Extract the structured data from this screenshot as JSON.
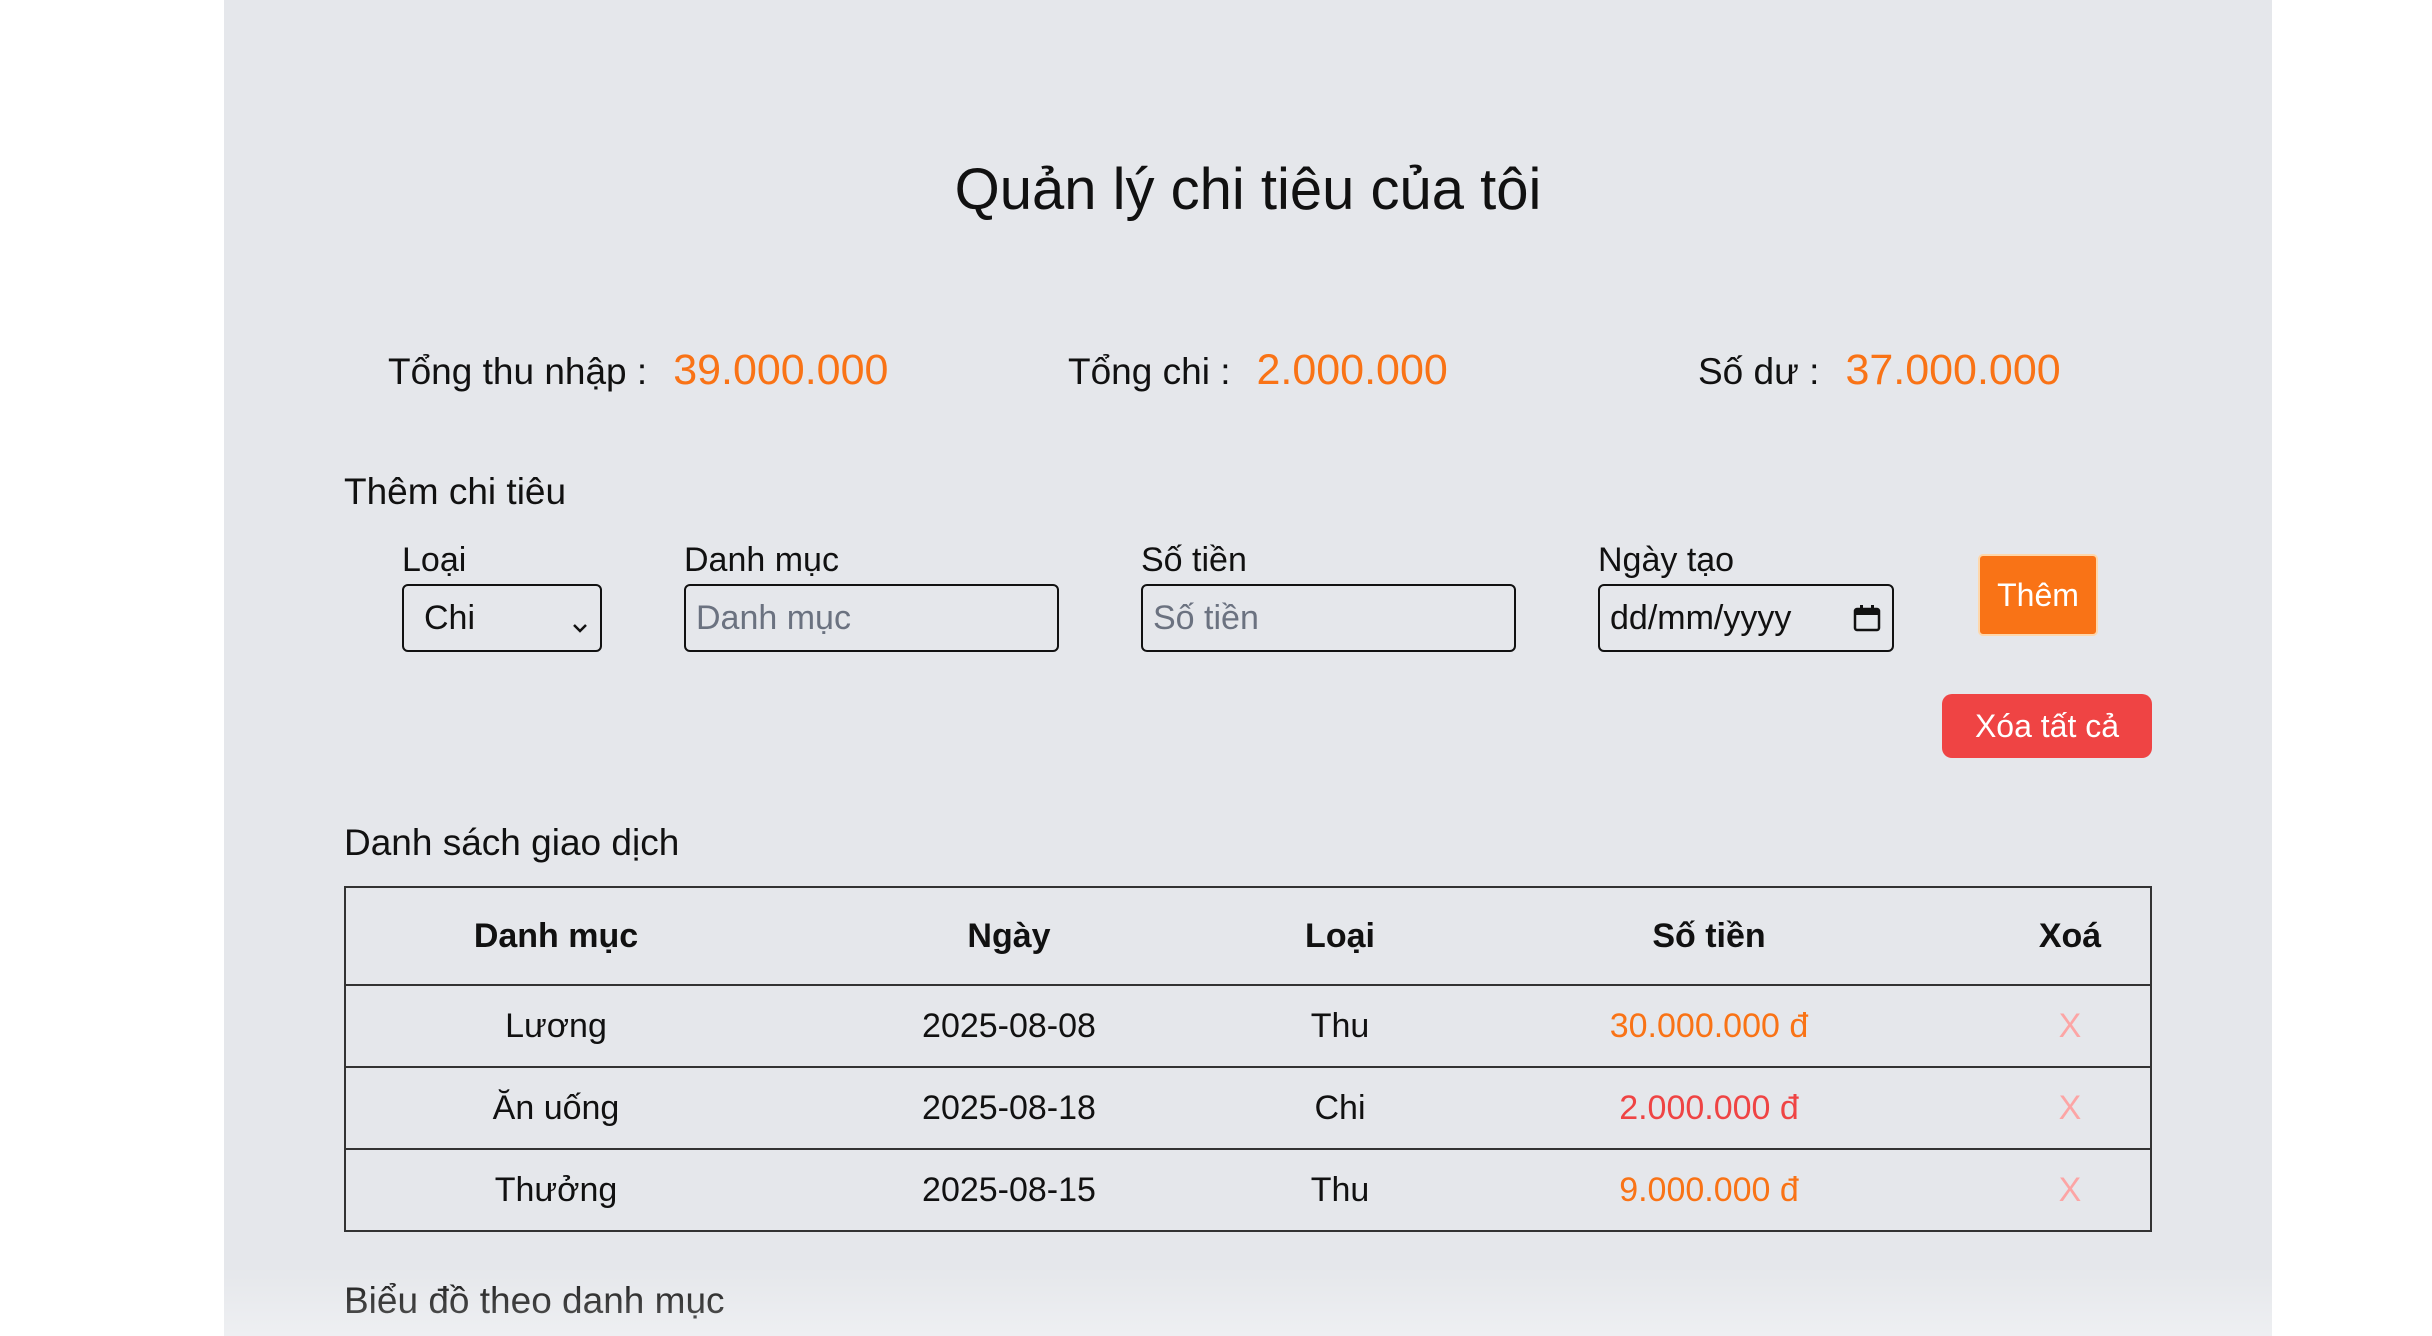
{
  "page": {
    "title": "Quản lý chi tiêu của tôi"
  },
  "summary": {
    "income_label": "Tổng thu nhập :",
    "income_value": "39.000.000",
    "expense_label": "Tổng chi :",
    "expense_value": "2.000.000",
    "balance_label": "Số dư :",
    "balance_value": "37.000.000"
  },
  "form": {
    "section_title": "Thêm chi tiêu",
    "type_label": "Loại",
    "type_selected": "Chi",
    "category_label": "Danh mục",
    "category_placeholder": "Danh mục",
    "amount_label": "Số tiền",
    "amount_placeholder": "Số tiền",
    "date_label": "Ngày tạo",
    "date_placeholder": "dd/mm/yyyy",
    "add_button": "Thêm",
    "clear_all_button": "Xóa tất cả"
  },
  "transactions": {
    "section_title": "Danh sách giao dịch",
    "headers": {
      "category": "Danh mục",
      "date": "Ngày",
      "type": "Loại",
      "amount": "Số tiền",
      "delete": "Xoá"
    },
    "rows": [
      {
        "category": "Lương",
        "date": "2025-08-08",
        "type": "Thu",
        "amount": "30.000.000 đ",
        "delete": "X"
      },
      {
        "category": "Ăn uống",
        "date": "2025-08-18",
        "type": "Chi",
        "amount": "2.000.000 đ",
        "delete": "X"
      },
      {
        "category": "Thưởng",
        "date": "2025-08-15",
        "type": "Thu",
        "amount": "9.000.000 đ",
        "delete": "X"
      }
    ]
  },
  "chart_section": {
    "title": "Biểu đồ theo danh mục"
  },
  "colors": {
    "accent_orange": "#f97316",
    "danger_red": "#ef4444",
    "panel_bg": "#e5e7eb",
    "delete_x": "#fca5a5"
  },
  "icons": {
    "select_arrow": "chevron-down-icon",
    "date_picker": "calendar-icon"
  }
}
